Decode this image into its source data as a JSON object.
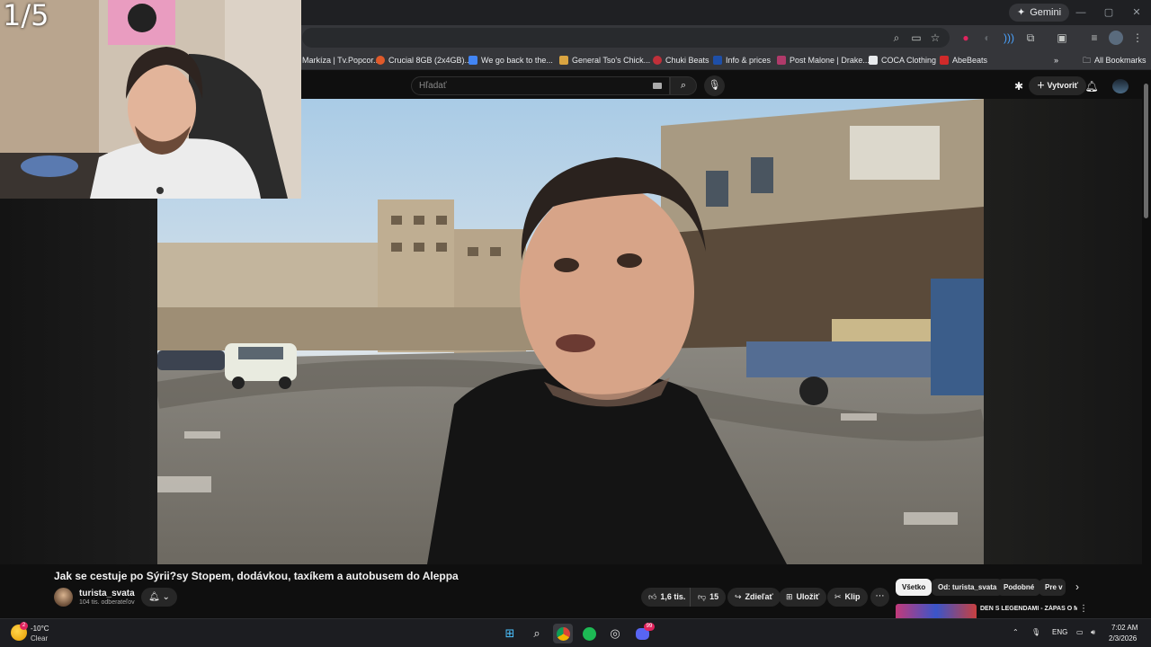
{
  "overlay": {
    "counter": "1/5"
  },
  "browser": {
    "gemini_label": "Gemini",
    "bookmarks": [
      {
        "label": "Markíza | Tv.Popcor...",
        "color": "#5a5a5a"
      },
      {
        "label": "Crucial 8GB (2x4GB)...",
        "color": "#e05a2a"
      },
      {
        "label": "We go back to the...",
        "color": "#4285f4"
      },
      {
        "label": "General Tso's Chick...",
        "color": "#d9a441"
      },
      {
        "label": "Chuki Beats",
        "color": "#c0303a"
      },
      {
        "label": "Info & prices",
        "color": "#1e4fa8"
      },
      {
        "label": "Post Malone | Drake...",
        "color": "#b03a6a"
      },
      {
        "label": "COCA Clothing",
        "color": "#e8eaed"
      },
      {
        "label": "AbeBeats",
        "color": "#d02a2a"
      }
    ],
    "all_bookmarks_label": "All Bookmarks"
  },
  "youtube": {
    "search_placeholder": "Hľadať",
    "create_label": "Vytvoriť",
    "video_title": "Jak se cestuje po Sýrii?sy Stopem, dodávkou, taxíkem a autobusem do Aleppa",
    "channel_name": "turista_svata",
    "channel_subs": "104 tis. odberateľov",
    "likes": "1,6 tis.",
    "dislikes": "15",
    "share_label": "Zdieľať",
    "save_label": "Uložiť",
    "clip_label": "Klip",
    "chips": [
      "Všetko",
      "Od: turista_svata",
      "Podobné",
      "Pre v"
    ],
    "recommendation_title": "DEN S LEGENDAMI - ZÁPAS O MILION KORUN - Cyrpe"
  },
  "taskbar": {
    "temperature": "-10°C",
    "condition": "Clear",
    "weather_badge": "2",
    "language": "ENG",
    "time": "7:02 AM",
    "date": "2/3/2026",
    "discord_badge": "99"
  }
}
